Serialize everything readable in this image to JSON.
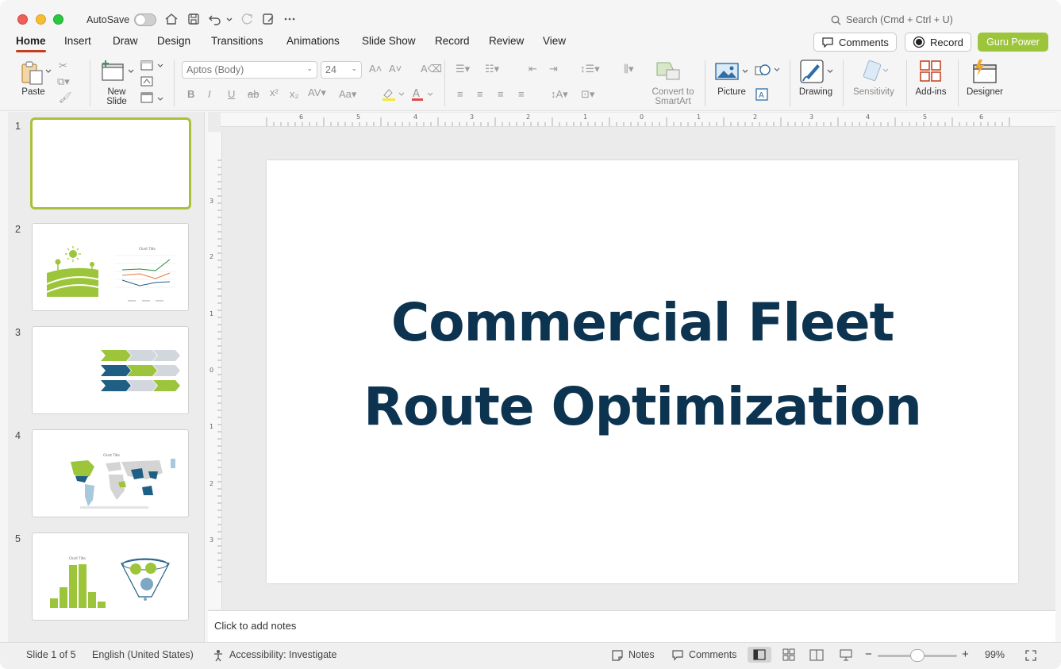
{
  "titlebar": {
    "autosave_label": "AutoSave",
    "search_placeholder": "Search (Cmd + Ctrl + U)"
  },
  "tabs": [
    "Home",
    "Insert",
    "Draw",
    "Design",
    "Transitions",
    "Animations",
    "Slide Show",
    "Record",
    "Review",
    "View"
  ],
  "header_buttons": {
    "comments": "Comments",
    "record": "Record",
    "guru_power": "Guru Power"
  },
  "ribbon": {
    "paste": "Paste",
    "new_slide_line1": "New",
    "new_slide_line2": "Slide",
    "font_name": "Aptos (Body)",
    "font_size": "24",
    "convert_line1": "Convert to",
    "convert_line2": "SmartArt",
    "picture": "Picture",
    "drawing": "Drawing",
    "sensitivity": "Sensitivity",
    "addins": "Add-ins",
    "designer": "Designer"
  },
  "slides": [
    {
      "number": "1"
    },
    {
      "number": "2"
    },
    {
      "number": "3"
    },
    {
      "number": "4"
    },
    {
      "number": "5"
    }
  ],
  "thumb_text": {
    "chart_title": "Chart Title"
  },
  "slide": {
    "title_line1": "Commercial Fleet",
    "title_line2": "Route Optimization"
  },
  "notes_placeholder": "Click to add notes",
  "status": {
    "slide_info": "Slide 1 of 5",
    "language": "English (United States)",
    "accessibility": "Accessibility: Investigate",
    "notes": "Notes",
    "comments": "Comments",
    "zoom": "99%",
    "zoom_level": 0.5
  },
  "colors": {
    "accent_tab": "#c43e1c",
    "brand_green": "#9dc53c",
    "title_navy": "#0c3350",
    "theme_blue": "#1f5f85"
  }
}
